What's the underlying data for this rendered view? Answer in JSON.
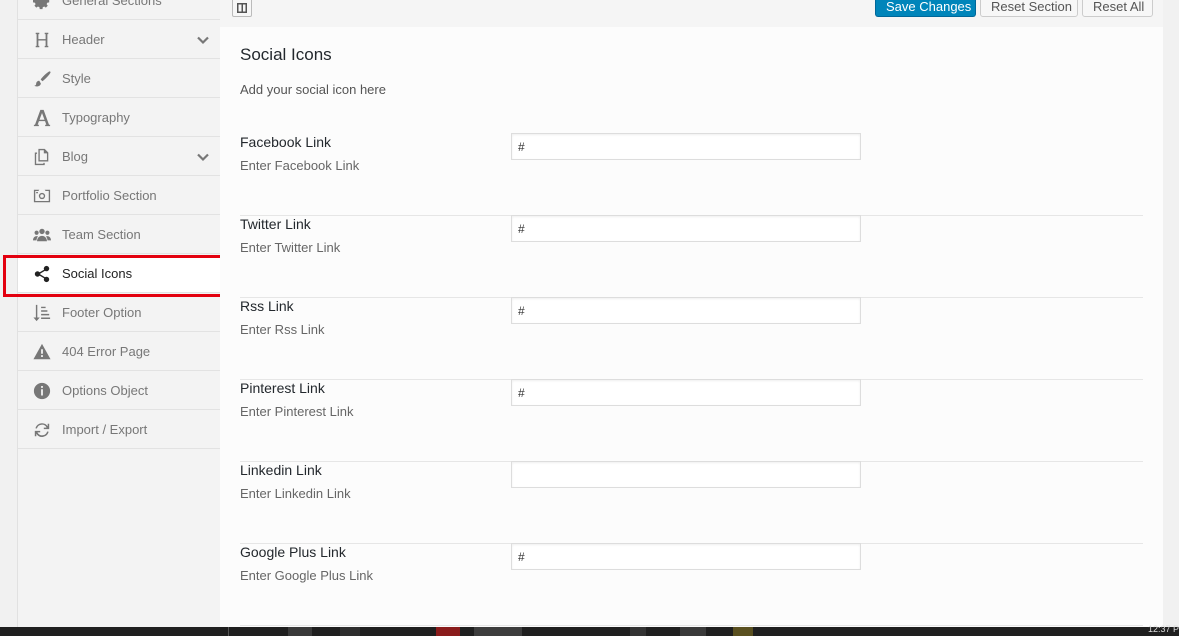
{
  "sidebar": {
    "items": [
      {
        "label": "General Sections",
        "icon": "gear-icon"
      },
      {
        "label": "Header",
        "icon": "header-h-icon",
        "has_children": true
      },
      {
        "label": "Style",
        "icon": "brush-icon"
      },
      {
        "label": "Typography",
        "icon": "font-a-icon"
      },
      {
        "label": "Blog",
        "icon": "copy-icon",
        "has_children": true
      },
      {
        "label": "Portfolio Section",
        "icon": "camera-icon"
      },
      {
        "label": "Team Section",
        "icon": "group-icon"
      },
      {
        "label": "Social Icons",
        "icon": "share-icon",
        "active": true
      },
      {
        "label": "Footer Option",
        "icon": "sort-icon"
      },
      {
        "label": "404 Error Page",
        "icon": "warning-icon"
      },
      {
        "label": "Options Object",
        "icon": "info-icon"
      },
      {
        "label": "Import / Export",
        "icon": "refresh-icon"
      }
    ]
  },
  "toolbar": {
    "save_label": "Save Changes",
    "reset_section_label": "Reset Section",
    "reset_all_label": "Reset All"
  },
  "section": {
    "title": "Social Icons",
    "description": "Add your social icon here"
  },
  "fields": [
    {
      "label": "Facebook Link",
      "sublabel": "Enter Facebook Link",
      "value": "#"
    },
    {
      "label": "Twitter Link",
      "sublabel": "Enter Twitter Link",
      "value": "#"
    },
    {
      "label": "Rss Link",
      "sublabel": "Enter Rss Link",
      "value": "#"
    },
    {
      "label": "Pinterest Link",
      "sublabel": "Enter Pinterest Link",
      "value": "#"
    },
    {
      "label": "Linkedin Link",
      "sublabel": "Enter Linkedin Link",
      "value": ""
    },
    {
      "label": "Google Plus Link",
      "sublabel": "Enter Google Plus Link",
      "value": "#"
    }
  ],
  "colors": {
    "accent": "#0085ba",
    "highlight_border": "#e3000f"
  },
  "taskbar": {
    "clock": "12:37 P"
  }
}
